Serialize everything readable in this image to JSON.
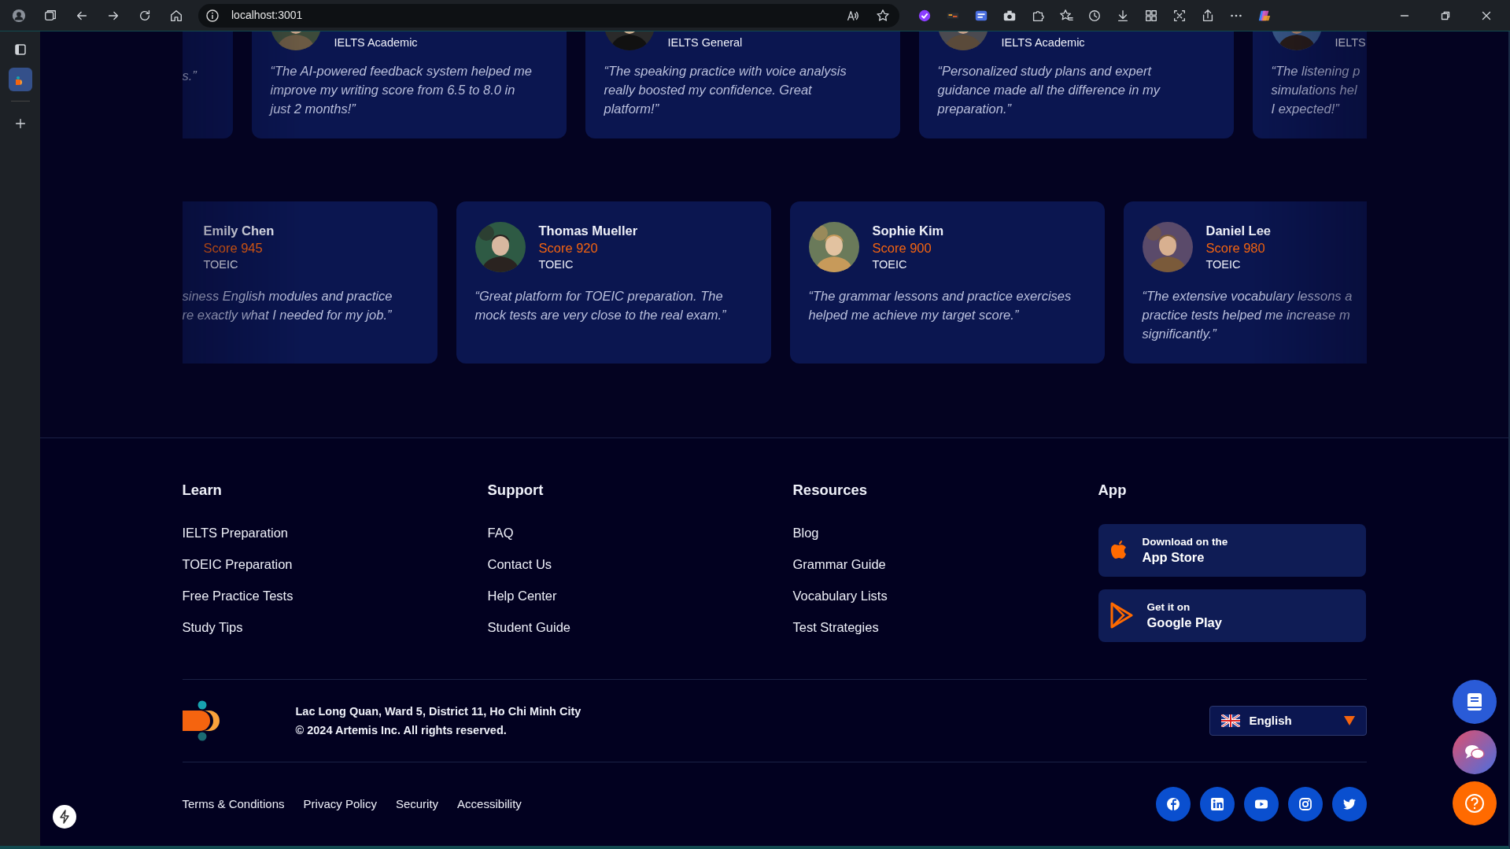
{
  "browser": {
    "address": "localhost:3001",
    "side_tabs": [
      {
        "kind": "page",
        "selected": false
      },
      {
        "kind": "app",
        "selected": true
      }
    ]
  },
  "testimonials_top": [
    {
      "quote": "s.”"
    },
    {
      "exam": "IELTS Academic",
      "quote": "“The AI-powered feedback system helped me\nimprove my writing score from 6.5 to 8.0 in\njust 2 months!”"
    },
    {
      "exam": "IELTS General",
      "quote": "“The speaking practice with voice analysis\nreally boosted my confidence. Great\nplatform!”"
    },
    {
      "exam": "IELTS Academic",
      "quote": "“Personalized study plans and expert\nguidance made all the difference in my\npreparation.”"
    },
    {
      "exam": "IELTS",
      "quote": "“The listening p\nsimulations hel\nI expected!”"
    }
  ],
  "testimonials_bottom": [
    {
      "name": "Emily Chen",
      "score": "Score 945",
      "exam": "TOEIC",
      "quote": "siness English modules and practice\nre exactly what I needed for my job.”"
    },
    {
      "name": "Thomas Mueller",
      "score": "Score 920",
      "exam": "TOEIC",
      "quote": "“Great platform for TOEIC preparation. The\nmock tests are very close to the real exam.”"
    },
    {
      "name": "Sophie Kim",
      "score": "Score 900",
      "exam": "TOEIC",
      "quote": "“The grammar lessons and practice exercises\nhelped me achieve my target score.”"
    },
    {
      "name": "Daniel Lee",
      "score": "Score 980",
      "exam": "TOEIC",
      "quote": "“The extensive vocabulary lessons a\npractice tests helped me increase m\nsignificantly.”"
    }
  ],
  "footer": {
    "columns": [
      {
        "title": "Learn",
        "links": [
          "IELTS Preparation",
          "TOEIC Preparation",
          "Free Practice Tests",
          "Study Tips"
        ]
      },
      {
        "title": "Support",
        "links": [
          "FAQ",
          "Contact Us",
          "Help Center",
          "Student Guide"
        ]
      },
      {
        "title": "Resources",
        "links": [
          "Blog",
          "Grammar Guide",
          "Vocabulary Lists",
          "Test Strategies"
        ]
      }
    ],
    "app": {
      "title": "App",
      "buttons": [
        {
          "kind": "apple",
          "line1": "Download on the",
          "line2": "App Store"
        },
        {
          "kind": "play",
          "line1": "Get it on",
          "line2": "Google Play"
        }
      ]
    },
    "address": "Lac Long Quan, Ward 5, District 11, Ho Chi Minh City",
    "copyright": "© 2024 Artemis Inc. All rights reserved.",
    "language": "English",
    "legal_links": [
      "Terms & Conditions",
      "Privacy Policy",
      "Security",
      "Accessibility"
    ]
  }
}
